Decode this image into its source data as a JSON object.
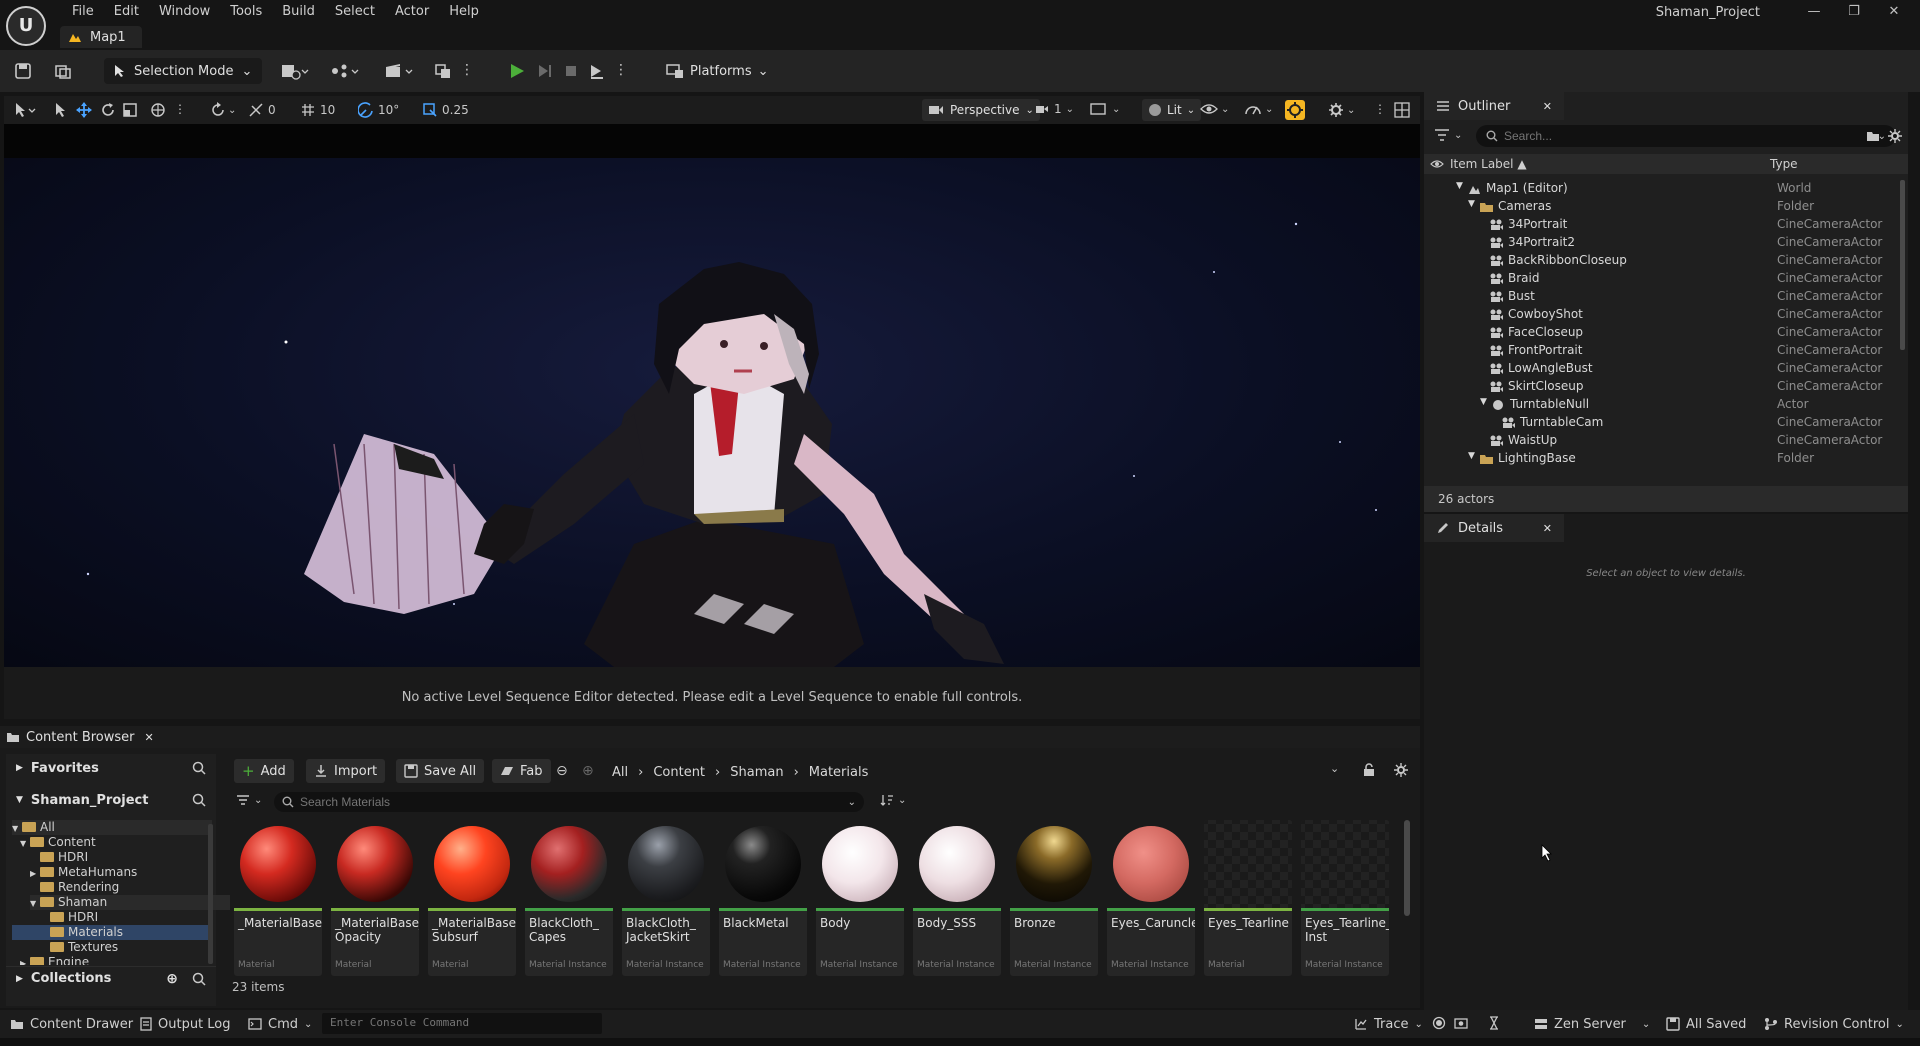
{
  "app": {
    "logo_text": "U",
    "menu": [
      "File",
      "Edit",
      "Window",
      "Tools",
      "Build",
      "Select",
      "Actor",
      "Help"
    ],
    "map_tab": "Map1",
    "project_name": "Shaman_Project"
  },
  "toolbar": {
    "selection_mode": "Selection Mode",
    "platforms": "Platforms"
  },
  "viewport_toolbar": {
    "rotation_snap": "0",
    "grid_snap": "10",
    "angle_snap": "10°",
    "scale_snap": "0.25",
    "view_mode": "Perspective",
    "camera_speed": "1",
    "lighting_mode": "Lit"
  },
  "viewport": {
    "sequencer_message": "No active Level Sequence Editor detected. Please edit a Level Sequence to enable full controls."
  },
  "outliner": {
    "title": "Outliner",
    "search_placeholder": "Search...",
    "col_label": "Item Label ▲",
    "col_type": "Type",
    "rows": [
      {
        "label": "Map1 (Editor)",
        "type": "World"
      },
      {
        "label": "Cameras",
        "type": "Folder"
      },
      {
        "label": "34Portrait",
        "type": "CineCameraActor"
      },
      {
        "label": "34Portrait2",
        "type": "CineCameraActor"
      },
      {
        "label": "BackRibbonCloseup",
        "type": "CineCameraActor"
      },
      {
        "label": "Braid",
        "type": "CineCameraActor"
      },
      {
        "label": "Bust",
        "type": "CineCameraActor"
      },
      {
        "label": "CowboyShot",
        "type": "CineCameraActor"
      },
      {
        "label": "FaceCloseup",
        "type": "CineCameraActor"
      },
      {
        "label": "FrontPortrait",
        "type": "CineCameraActor"
      },
      {
        "label": "LowAngleBust",
        "type": "CineCameraActor"
      },
      {
        "label": "SkirtCloseup",
        "type": "CineCameraActor"
      },
      {
        "label": "TurntableNull",
        "type": "Actor"
      },
      {
        "label": "TurntableCam",
        "type": "CineCameraActor"
      },
      {
        "label": "WaistUp",
        "type": "CineCameraActor"
      },
      {
        "label": "LightingBase",
        "type": "Folder"
      }
    ],
    "actor_count": "26 actors"
  },
  "details": {
    "title": "Details",
    "empty_message": "Select an object to view details."
  },
  "content_browser": {
    "tab_title": "Content Browser",
    "favorites": "Favorites",
    "project": "Shaman_Project",
    "tree": [
      "All",
      "Content",
      "HDRI",
      "MetaHumans",
      "Rendering",
      "Shaman",
      "HDRI",
      "Materials",
      "Textures",
      "Engine"
    ],
    "collections": "Collections",
    "buttons": {
      "add": "Add",
      "import": "Import",
      "save_all": "Save All",
      "fab": "Fab"
    },
    "breadcrumb": [
      "All",
      "Content",
      "Shaman",
      "Materials"
    ],
    "search_placeholder": "Search Materials",
    "assets": [
      {
        "name": "_MaterialBase",
        "kind": "Material"
      },
      {
        "name": "_MaterialBase_ Opacity",
        "kind": "Material"
      },
      {
        "name": "_MaterialBase Subsurf",
        "kind": "Material"
      },
      {
        "name": "BlackCloth_ Capes",
        "kind": "Material Instance"
      },
      {
        "name": "BlackCloth_ JacketSkirt",
        "kind": "Material Instance"
      },
      {
        "name": "BlackMetal",
        "kind": "Material Instance"
      },
      {
        "name": "Body",
        "kind": "Material Instance"
      },
      {
        "name": "Body_SSS",
        "kind": "Material Instance"
      },
      {
        "name": "Bronze",
        "kind": "Material Instance"
      },
      {
        "name": "Eyes_Caruncles",
        "kind": "Material Instance"
      },
      {
        "name": "Eyes_Tearline",
        "kind": "Material"
      },
      {
        "name": "Eyes_Tearline_ Inst",
        "kind": "Material Instance"
      }
    ],
    "items_count": "23 items"
  },
  "statusbar": {
    "content_drawer": "Content Drawer",
    "output_log": "Output Log",
    "cmd": "Cmd",
    "console_placeholder": "Enter Console Command",
    "trace": "Trace",
    "zen_server": "Zen Server",
    "all_saved": "All Saved",
    "revision_control": "Revision Control"
  },
  "colors": {
    "accent_yellow": "#f5b622",
    "play_green": "#4caf3a",
    "folder": "#c9a355",
    "material_bar": "#7cb342",
    "instance_bar": "#43a047"
  }
}
